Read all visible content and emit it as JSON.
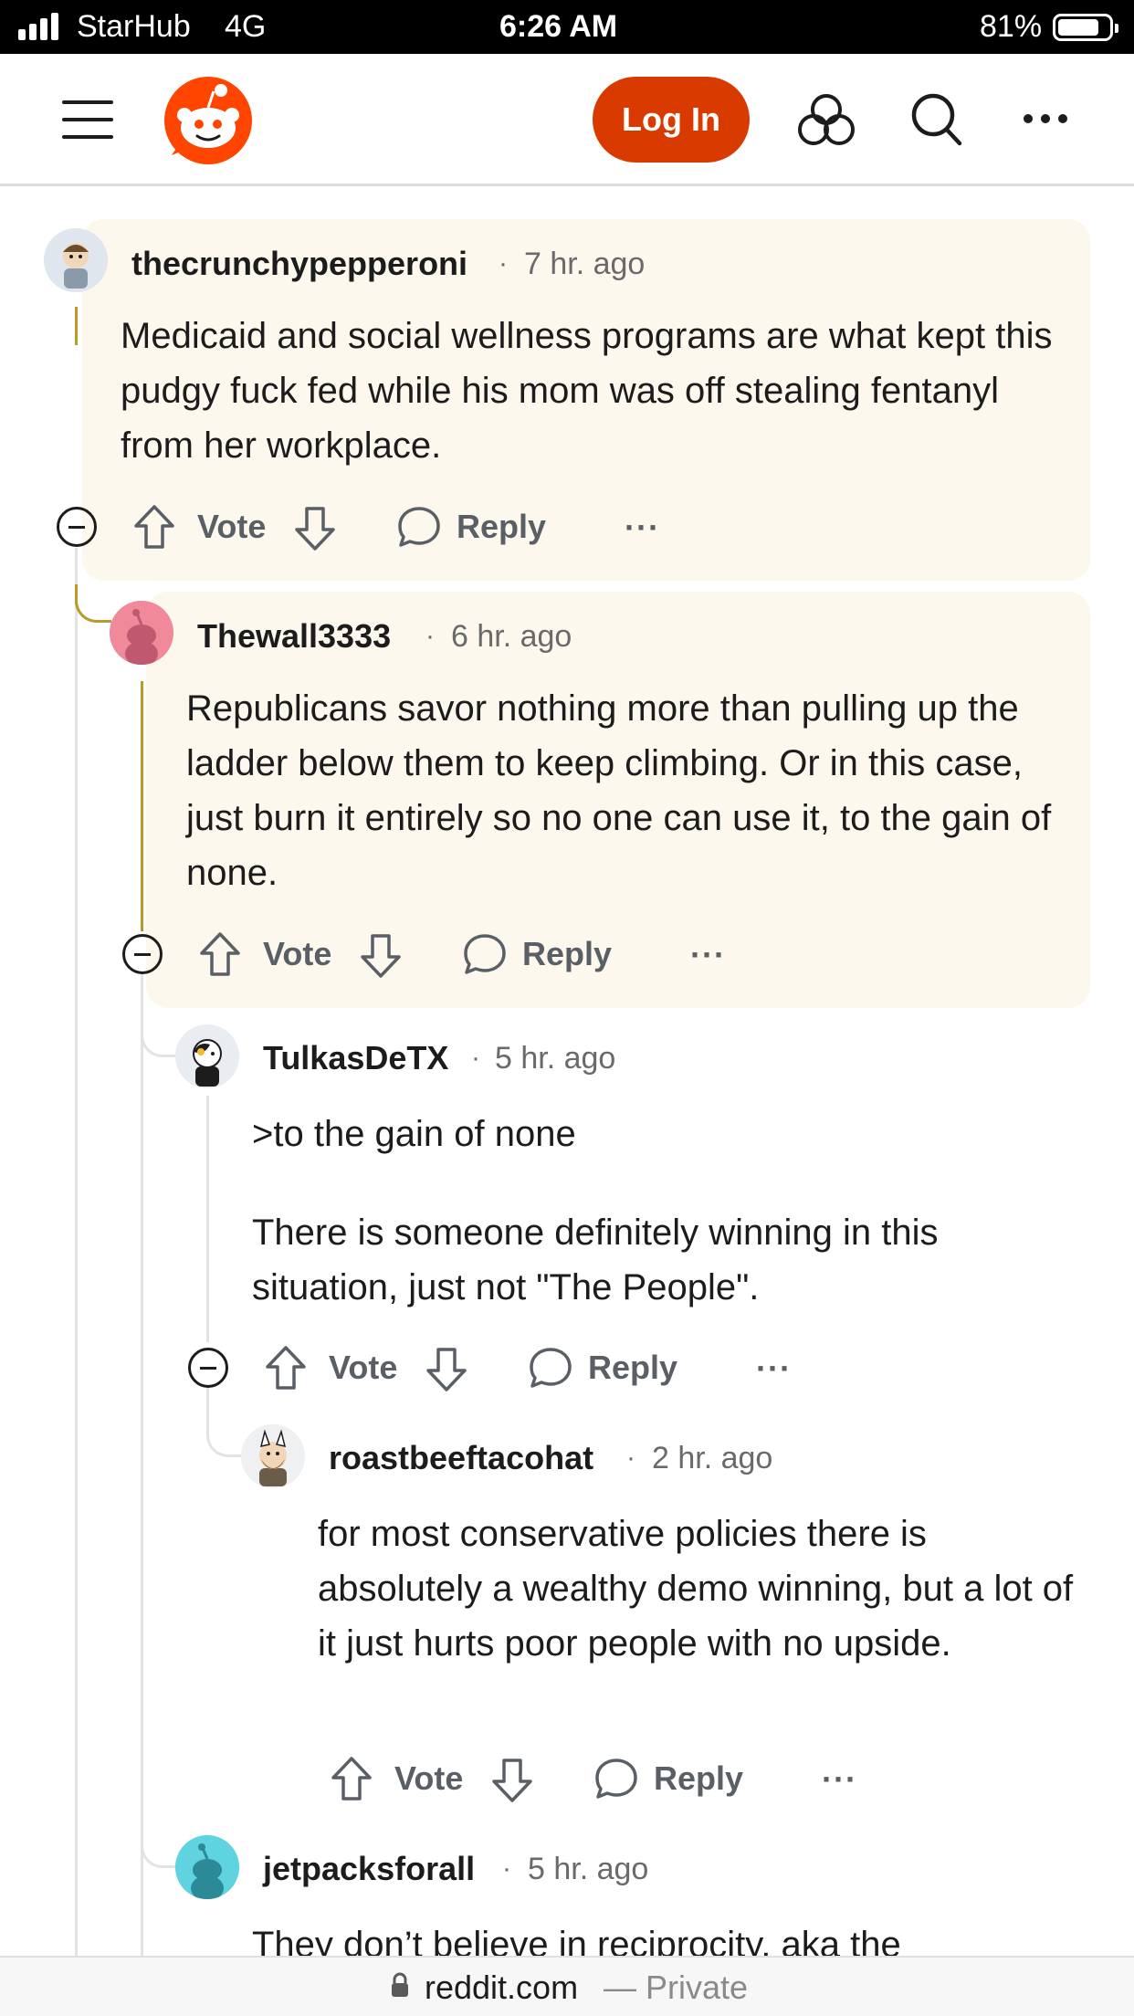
{
  "status_bar": {
    "carrier": "StarHub",
    "network": "4G",
    "time": "6:26 AM",
    "battery": "81%",
    "battery_level": 0.81
  },
  "header": {
    "login_label": "Log In"
  },
  "actions": {
    "vote": "Vote",
    "reply": "Reply",
    "more": "···"
  },
  "comments": [
    {
      "username": "thecrunchypepperoni",
      "time": "7 hr. ago",
      "body": "Medicaid and social wellness programs are what kept this pudgy fuck fed while his mom was off stealing fentanyl from her workplace."
    },
    {
      "username": "Thewall3333",
      "time": "6 hr. ago",
      "body": "Republicans savor nothing more than pulling up the ladder below them to keep climbing. Or in this case, just burn it entirely so no one can use it, to the gain of none."
    },
    {
      "username": "TulkasDeTX",
      "time": "5 hr. ago",
      "body_quote": ">to the gain of none",
      "body": "There is someone definitely winning in this situation, just not \"The People\"."
    },
    {
      "username": "roastbeeftacohat",
      "time": "2 hr. ago",
      "body": "for most conservative policies there is absolutely a wealthy demo winning, but a lot of it just hurts poor people with no upside."
    },
    {
      "username": "jetpacksforall",
      "time": "5 hr. ago",
      "body": "They don’t believe in reciprocity, aka the"
    }
  ],
  "bottom_bar": {
    "domain": "reddit.com",
    "privacy": "— Private"
  },
  "colors": {
    "brand": "#d93a00",
    "card_bg": "#fdf8ee",
    "thread_active": "#b99a2a"
  }
}
